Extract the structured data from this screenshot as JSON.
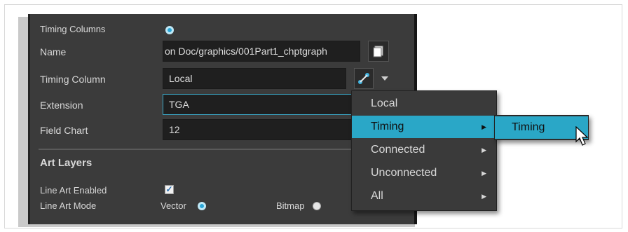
{
  "panel": {
    "timing_columns_label": "Timing Columns",
    "name_label": "Name",
    "name_value": "on Doc/graphics/001Part1_chptgraph",
    "timing_column_label": "Timing Column",
    "timing_column_value": "Local",
    "extension_label": "Extension",
    "extension_value": "TGA",
    "field_chart_label": "Field Chart",
    "field_chart_value": "12",
    "art_layers_heading": "Art Layers",
    "line_art_enabled_label": "Line Art Enabled",
    "line_art_mode_label": "Line Art Mode",
    "vector_label": "Vector",
    "bitmap_label": "Bitmap"
  },
  "menu": {
    "items": [
      {
        "label": "Local"
      },
      {
        "label": "Timing"
      },
      {
        "label": "Connected"
      },
      {
        "label": "Unconnected"
      },
      {
        "label": "All"
      }
    ],
    "submenu_items": [
      {
        "label": "Timing"
      }
    ]
  },
  "colors": {
    "highlight": "#2aa7c7",
    "panel_bg": "#3b3b3b"
  }
}
